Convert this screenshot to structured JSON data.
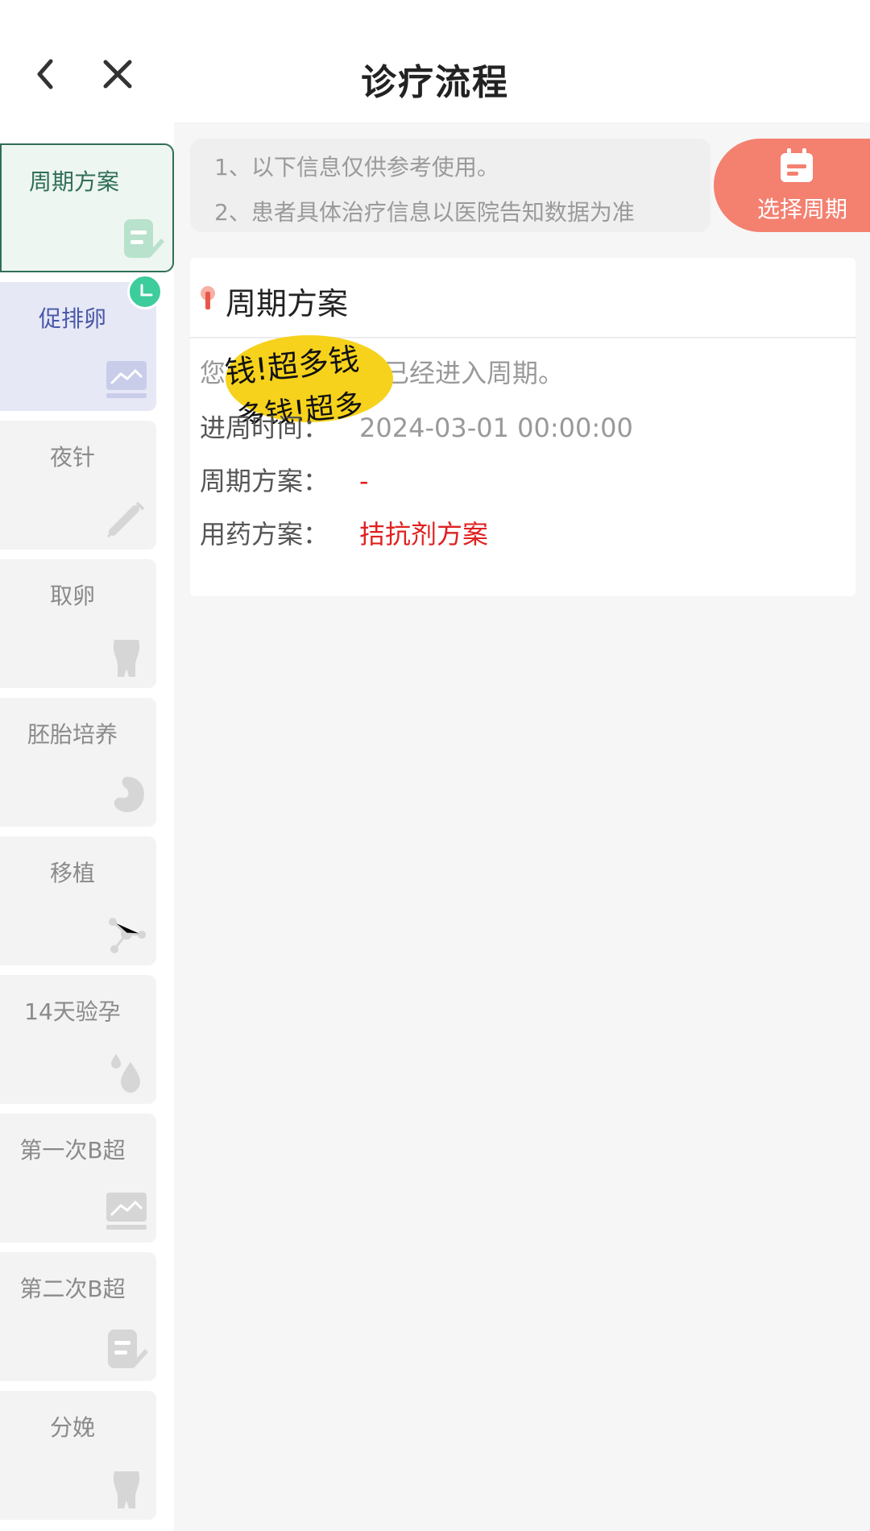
{
  "header": {
    "title": "诊疗流程"
  },
  "sidebar": {
    "items": [
      {
        "label": "周期方案"
      },
      {
        "label": "促排卵"
      },
      {
        "label": "夜针"
      },
      {
        "label": "取卵"
      },
      {
        "label": "胚胎培养"
      },
      {
        "label": "移植"
      },
      {
        "label": "14天验孕"
      },
      {
        "label": "第一次B超"
      },
      {
        "label": "第二次B超"
      },
      {
        "label": "分娩"
      }
    ]
  },
  "notice": {
    "line1": "1、以下信息仅供参考使用。",
    "line2": "2、患者具体治疗信息以医院告知数据为准"
  },
  "select_button": {
    "label": "选择周期"
  },
  "card": {
    "title": "周期方案",
    "status_prefix": "您",
    "status_suffix": "已经进入周期。",
    "rows": [
      {
        "key": "进周时间：",
        "value": "2024-03-01 00:00:00"
      },
      {
        "key": "周期方案：",
        "value": "-"
      },
      {
        "key": "用药方案：",
        "value": "拮抗剂方案"
      }
    ],
    "sticker_text_1": "钱!超多钱",
    "sticker_text_2": "多钱!超多"
  },
  "colors": {
    "accent_green": "#2f6f56",
    "badge_green": "#3dcc9c",
    "select_button": "#f48070",
    "value_red": "#e02020"
  }
}
